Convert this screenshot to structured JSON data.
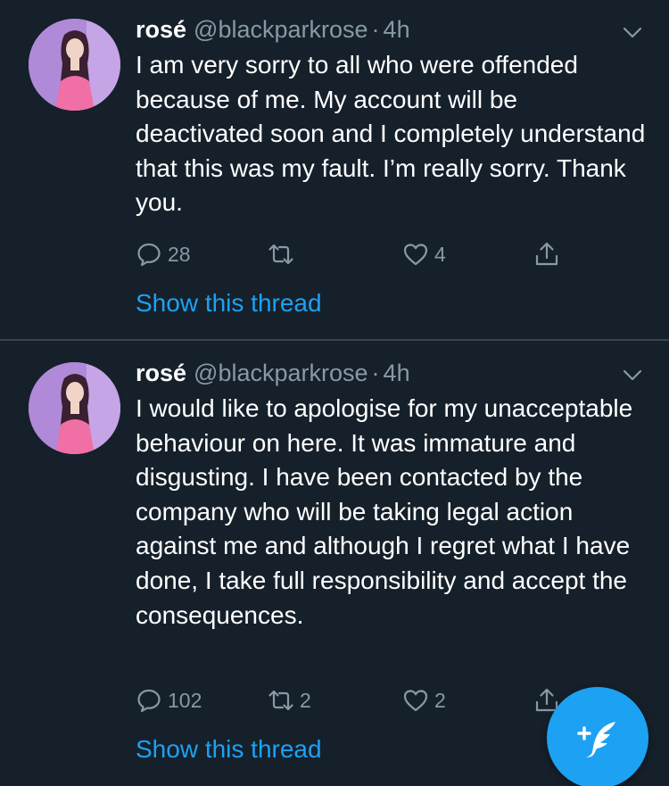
{
  "tweets": [
    {
      "display_name": "rosé",
      "handle": "@blackparkrose",
      "separator": "·",
      "time": "4h",
      "text": "I am very sorry to all who were offended because of me. My account will be deactivated soon and I completely understand that this was my fault. I’m really sorry. Thank you.",
      "reply_count": "28",
      "retweet_count": "",
      "like_count": "4",
      "thread_link": "Show this thread"
    },
    {
      "display_name": "rosé",
      "handle": "@blackparkrose",
      "separator": "·",
      "time": "4h",
      "text": "I would like to apologise for my unacceptable behaviour on here. It was immature and disgusting. I have been contacted by the company who will be taking legal action against me and although I regret what I have done, I take full responsibility and accept the consequences.",
      "reply_count": "102",
      "retweet_count": "2",
      "like_count": "2",
      "thread_link": "Show this thread"
    }
  ],
  "icons": {
    "reply": "reply-icon",
    "retweet": "retweet-icon",
    "like": "heart-icon",
    "share": "share-icon",
    "more": "chevron-down-icon",
    "compose": "compose-tweet-icon"
  },
  "colors": {
    "background": "#15202b",
    "divider": "#38444d",
    "secondary_text": "#8899a6",
    "accent": "#1da1f2",
    "primary_text": "#ffffff"
  }
}
